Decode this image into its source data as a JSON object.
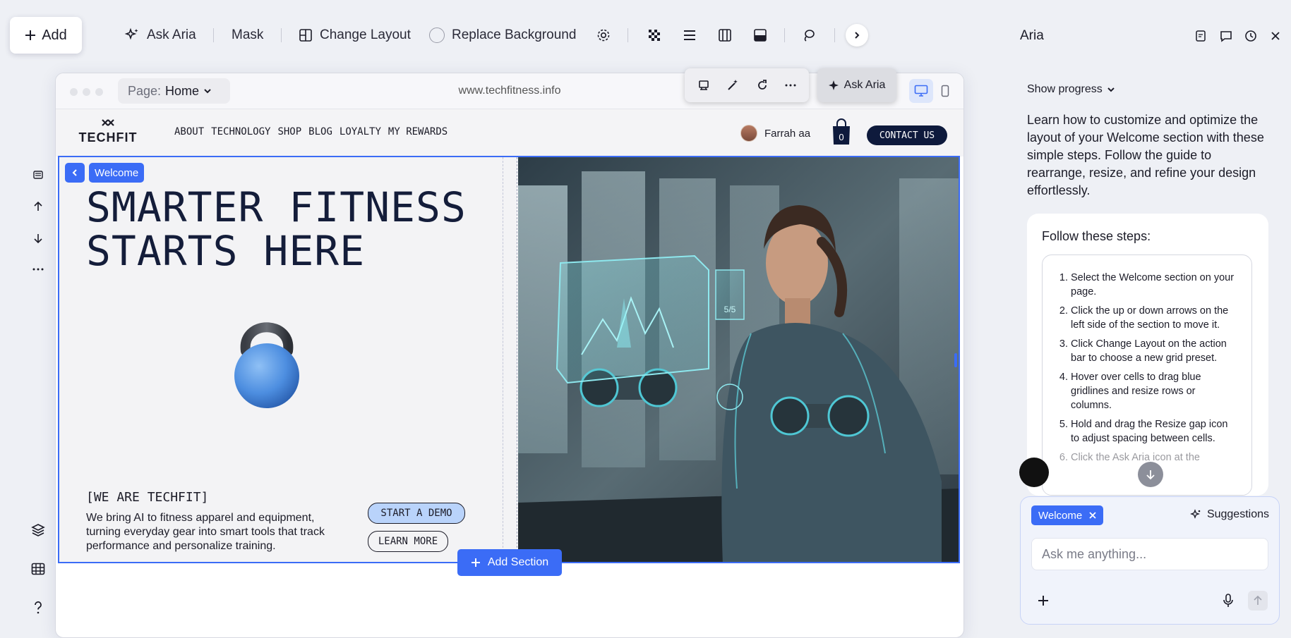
{
  "toolbar": {
    "add_label": "Add",
    "ask_aria_label": "Ask Aria",
    "mask_label": "Mask",
    "change_layout_label": "Change Layout",
    "replace_background_label": "Replace Background"
  },
  "browser": {
    "page_prefix": "Page:",
    "page_name": "Home",
    "url": "www.techfitness.info"
  },
  "site": {
    "logo_text": "TECHFIT",
    "nav": [
      "ABOUT",
      "TECHNOLOGY",
      "SHOP",
      "BLOG",
      "LOYALTY",
      "MY REWARDS"
    ],
    "user_name": "Farrah aa",
    "cart_count": "0",
    "contact_label": "CONTACT US"
  },
  "hero": {
    "section_tag": "Welcome",
    "headline_line1": "SMARTER FITNESS",
    "headline_line2": "STARTS HERE",
    "subheading": "[WE ARE TECHFIT]",
    "description": "We bring AI to fitness apparel and equipment, turning everyday gear into smart tools that track performance and personalize training.",
    "demo_label": "START A DEMO",
    "learn_label": "LEARN MORE",
    "ask_aria_label": "Ask Aria",
    "image_holo_text": "5/5"
  },
  "add_section_label": "Add Section",
  "panel": {
    "title": "Aria",
    "show_progress": "Show progress",
    "intro": "Learn how to customize and optimize the layout of your Welcome section with these simple steps. Follow the guide to rearrange, resize, and refine your design effortlessly.",
    "steps_heading": "Follow these steps:",
    "steps": [
      "Select the Welcome section on your page.",
      "Click the up or down arrows on the left side of the section to move it.",
      "Click Change Layout on the action bar to choose a new grid preset.",
      "Hover over cells to drag blue gridlines and resize rows or columns.",
      "Hold and drag the Resize gap icon to adjust spacing between cells.",
      "Click the Ask Aria icon at the"
    ],
    "chat_tag": "Welcome",
    "suggestions_label": "Suggestions",
    "chat_placeholder": "Ask me anything..."
  },
  "colors": {
    "accent": "#3b6cf6",
    "navy": "#0e1a3c",
    "demo_pill": "#b9d3fb"
  }
}
